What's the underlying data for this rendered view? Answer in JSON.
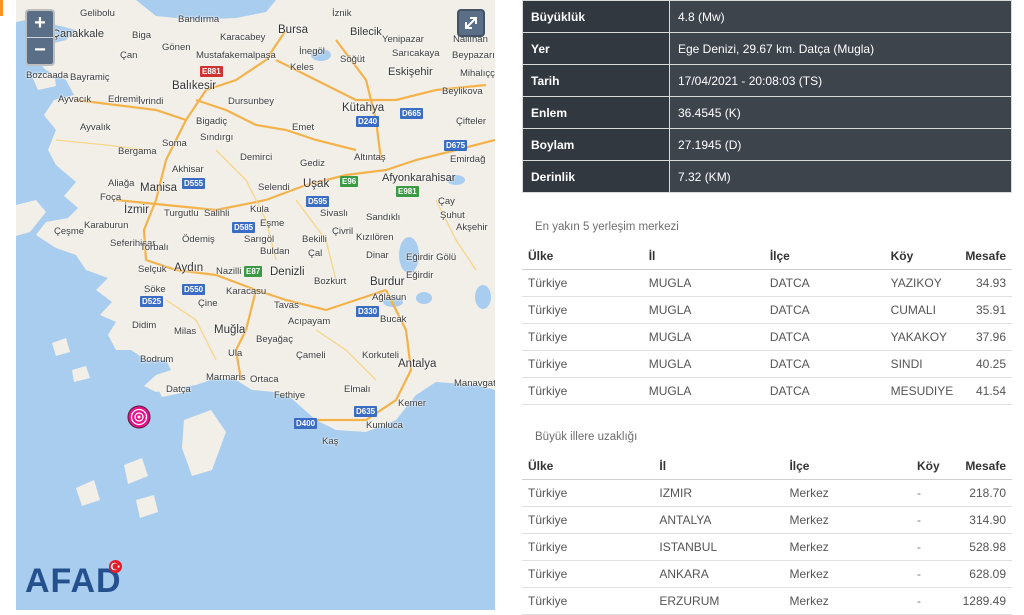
{
  "map": {
    "zoom_in": "+",
    "zoom_out": "−",
    "fullscreen_icon": "expand-icon",
    "brand": "AFAD",
    "places": [
      "Gelibolu",
      "Bandırma",
      "İznik",
      "Bilecik",
      "Nallıhan",
      "Çanakkale",
      "Biga",
      "Gönen",
      "Karacabey",
      "Bursa",
      "Yenipazar",
      "Sarıcakaya",
      "Çan",
      "Mustafakemalpaşa",
      "İnegöl",
      "Söğüt",
      "Beypazarı",
      "Bozcaada",
      "Bayramiç",
      "Keles",
      "Eskişehir",
      "Mihalıççık",
      "Ayvacık",
      "Edremit",
      "İvrindi",
      "Balıkesir",
      "Dursunbey",
      "Beylikova",
      "Ayvalık",
      "Kütahya",
      "Bigadiç",
      "Emet",
      "Çifteler",
      "Bergama",
      "Soma",
      "Sındırgı",
      "Emirdağ",
      "Demirci",
      "Gediz",
      "Altıntaş",
      "Akhisar",
      "Afyonkarahisar",
      "Aliağa",
      "Manisa",
      "Selendi",
      "Uşak",
      "Çay",
      "Foça",
      "Turgutlu",
      "İzmir",
      "Kula",
      "Sandıklı",
      "Şuhut",
      "Çeşme",
      "Karaburun",
      "Salihli",
      "Eşme",
      "Sivaslı",
      "Akşehir",
      "Seferihisar",
      "Ödemiş",
      "Sarıgöl",
      "Bekilli",
      "Çivril",
      "Kızılören",
      "Torbalı",
      "Buldan",
      "Çal",
      "Dinar",
      "Eğirdir Gölü",
      "Selçuk",
      "Aydın",
      "Nazilli",
      "Denizli",
      "Bozkurt",
      "Burdur",
      "Eğirdir",
      "Söke",
      "Karacasu",
      "Tavas",
      "Ağlasun",
      "Çine",
      "Bucak",
      "Didim",
      "Milas",
      "Acıpayam",
      "Muğla",
      "Beyağaç",
      "Bodrum",
      "Ula",
      "Çameli",
      "Korkuteli",
      "Antalya",
      "Datça",
      "Marmaris",
      "Ortaca",
      "Elmalı",
      "Manavgat",
      "Fethiye",
      "Kemer",
      "Kumluca",
      "Kaş"
    ],
    "roads": [
      "E881",
      "D240",
      "D665",
      "D675",
      "E96",
      "E981",
      "D555",
      "D595",
      "D585",
      "E87",
      "D550",
      "D525",
      "D330",
      "D400",
      "D635"
    ]
  },
  "details": [
    {
      "label": "Büyüklük",
      "value": "4.8 (Mw)"
    },
    {
      "label": "Yer",
      "value": "Ege Denizi, 29.67 km. Datça (Mugla)"
    },
    {
      "label": "Tarih",
      "value": "17/04/2021 - 20:08:03 (TS)"
    },
    {
      "label": "Enlem",
      "value": "36.4545 (K)"
    },
    {
      "label": "Boylam",
      "value": "27.1945 (D)"
    },
    {
      "label": "Derinlik",
      "value": "7.32 (KM)"
    }
  ],
  "nearest": {
    "title": "En yakın 5 yerleşim merkezi",
    "headers": [
      "Ülke",
      "İl",
      "İlçe",
      "Köy",
      "Mesafe"
    ],
    "rows": [
      [
        "Türkiye",
        "MUGLA",
        "DATCA",
        "YAZIKOY",
        "34.93"
      ],
      [
        "Türkiye",
        "MUGLA",
        "DATCA",
        "CUMALI",
        "35.91"
      ],
      [
        "Türkiye",
        "MUGLA",
        "DATCA",
        "YAKAKOY",
        "37.96"
      ],
      [
        "Türkiye",
        "MUGLA",
        "DATCA",
        "SINDI",
        "40.25"
      ],
      [
        "Türkiye",
        "MUGLA",
        "DATCA",
        "MESUDIYE",
        "41.54"
      ]
    ]
  },
  "cities": {
    "title": "Büyük illere uzaklığı",
    "headers": [
      "Ülke",
      "İl",
      "İlçe",
      "Köy",
      "Mesafe"
    ],
    "rows": [
      [
        "Türkiye",
        "IZMIR",
        "Merkez",
        "-",
        "218.70"
      ],
      [
        "Türkiye",
        "ANTALYA",
        "Merkez",
        "-",
        "314.90"
      ],
      [
        "Türkiye",
        "ISTANBUL",
        "Merkez",
        "-",
        "528.98"
      ],
      [
        "Türkiye",
        "ANKARA",
        "Merkez",
        "-",
        "628.09"
      ],
      [
        "Türkiye",
        "ERZURUM",
        "Merkez",
        "-",
        "1289.49"
      ]
    ]
  }
}
